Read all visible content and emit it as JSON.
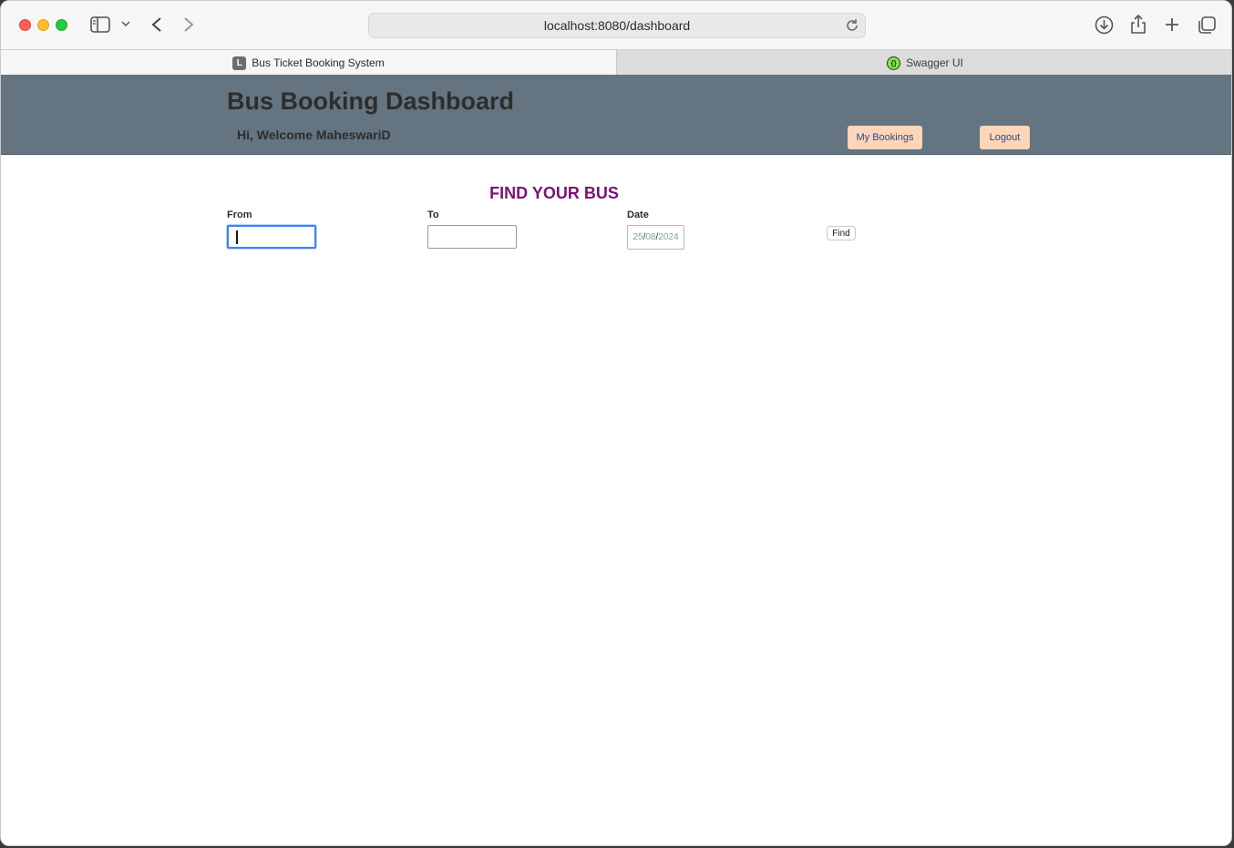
{
  "browser": {
    "url": "localhost:8080/dashboard",
    "tabs": [
      {
        "label": "Bus Ticket Booking System",
        "favicon": "L",
        "active": true
      },
      {
        "label": "Swagger UI",
        "favicon": "swagger-icon",
        "active": false
      }
    ]
  },
  "header": {
    "title": "Bus Booking Dashboard",
    "welcome": "Hi, Welcome MaheswariD",
    "my_bookings_label": "My Bookings",
    "logout_label": "Logout",
    "background_color": "#647481",
    "button_color": "#fdd5b8"
  },
  "search": {
    "title": "FIND YOUR BUS",
    "title_color": "#7a1274",
    "from_label": "From",
    "from_value": "",
    "to_label": "To",
    "to_value": "",
    "date_label": "Date",
    "date_day": "25",
    "date_month": "08",
    "date_year": "2024",
    "find_label": "Find"
  }
}
